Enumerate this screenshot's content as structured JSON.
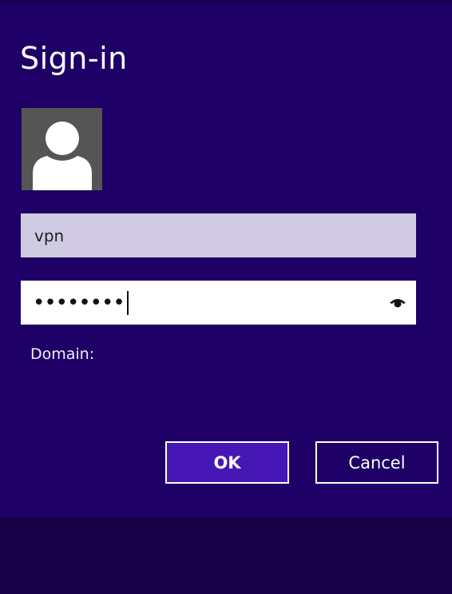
{
  "dialog": {
    "title": "Sign-in",
    "avatar_icon": "user-silhouette-icon",
    "username_value": "vpn",
    "password_mask": "••••••••",
    "reveal_icon": "eye-icon",
    "domain_label": "Domain:",
    "ok_label": "OK",
    "cancel_label": "Cancel"
  },
  "colors": {
    "background": "#1e0066",
    "ok_button": "#4617b4",
    "username_field": "#d0cbe3"
  }
}
